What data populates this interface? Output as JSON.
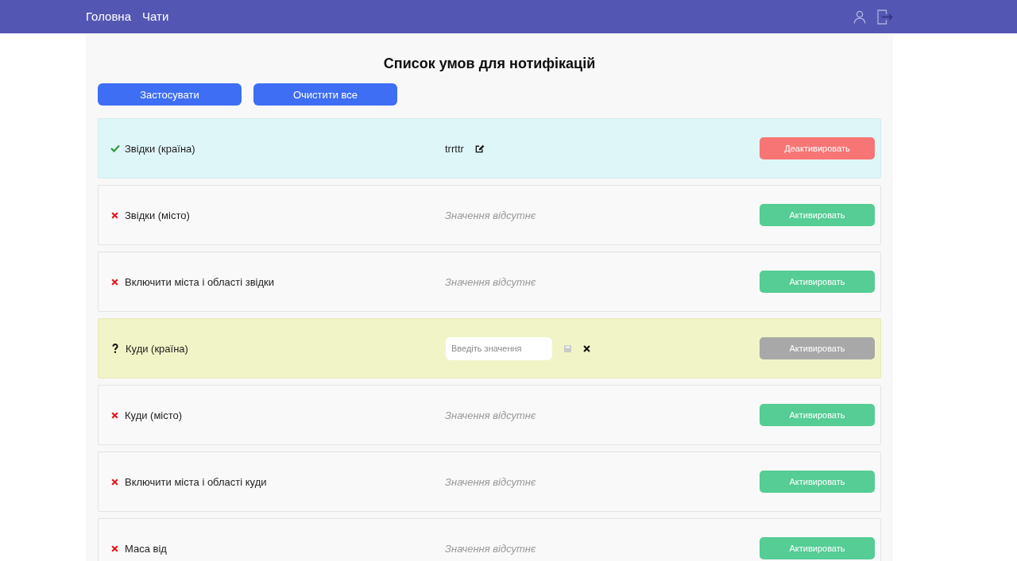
{
  "nav": {
    "links": [
      {
        "label": "Головна"
      },
      {
        "label": "Чати"
      }
    ]
  },
  "page": {
    "title": "Список умов для нотифікацій",
    "buttons": [
      "Застосувати",
      "Очистити все"
    ]
  },
  "conditions": [
    {
      "kind": "active",
      "label": "Звідки (країна)",
      "value": "trrttr",
      "button": {
        "label": "Деактивировать",
        "disabled": false
      }
    },
    {
      "kind": "inactive",
      "label": "Звідки (місто)",
      "empty_value_text": "Значення відсутнє",
      "button": {
        "label": "Активировать",
        "disabled": false
      }
    },
    {
      "kind": "inactive",
      "label": "Включити міста і області звідки",
      "empty_value_text": "Значення відсутнє",
      "button": {
        "label": "Активировать",
        "disabled": false
      }
    },
    {
      "kind": "editing",
      "label": "Куди (країна)",
      "input": {
        "placeholder": "Введіть значення"
      },
      "button": {
        "label": "Активировать",
        "disabled": true
      }
    },
    {
      "kind": "inactive",
      "label": "Куди (місто)",
      "empty_value_text": "Значення відсутнє",
      "button": {
        "label": "Активировать",
        "disabled": false
      }
    },
    {
      "kind": "inactive",
      "label": "Включити міста і області куди",
      "empty_value_text": "Значення відсутнє",
      "button": {
        "label": "Активировать",
        "disabled": false
      }
    },
    {
      "kind": "inactive",
      "label": "Маса від",
      "empty_value_text": "Значення відсутнє",
      "button": {
        "label": "Активировать",
        "disabled": false
      }
    }
  ]
}
